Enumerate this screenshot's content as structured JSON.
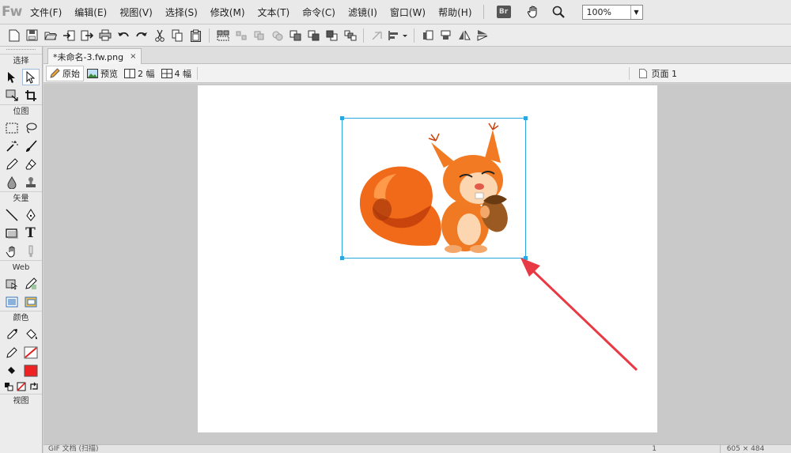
{
  "app": {
    "logo": "Fw"
  },
  "menubar": {
    "items": [
      "文件(F)",
      "编辑(E)",
      "视图(V)",
      "选择(S)",
      "修改(M)",
      "文本(T)",
      "命令(C)",
      "滤镜(I)",
      "窗口(W)",
      "帮助(H)"
    ],
    "bridge_badge": "Br",
    "zoom": "100%"
  },
  "document": {
    "tab_title": "*未命名-3.fw.png",
    "tab_close": "×",
    "views": {
      "original": "原始",
      "preview": "预览",
      "two_up": "2 幅",
      "four_up": "4 幅"
    },
    "page": "页面 1"
  },
  "tools": {
    "sections": {
      "select": "选择",
      "bitmap": "位图",
      "vector": "矢量",
      "web": "Web",
      "colors": "颜色",
      "view": "视图"
    },
    "text_tool": "T",
    "stroke_color": "#e02020",
    "fill_color": "#ee2222"
  },
  "status": {
    "left": "GIF 文档 (扫描)",
    "page_num": "1",
    "size": "605 × 484"
  },
  "colors": {
    "selection": "#2aa6e0",
    "arrow": "#e83a44"
  }
}
